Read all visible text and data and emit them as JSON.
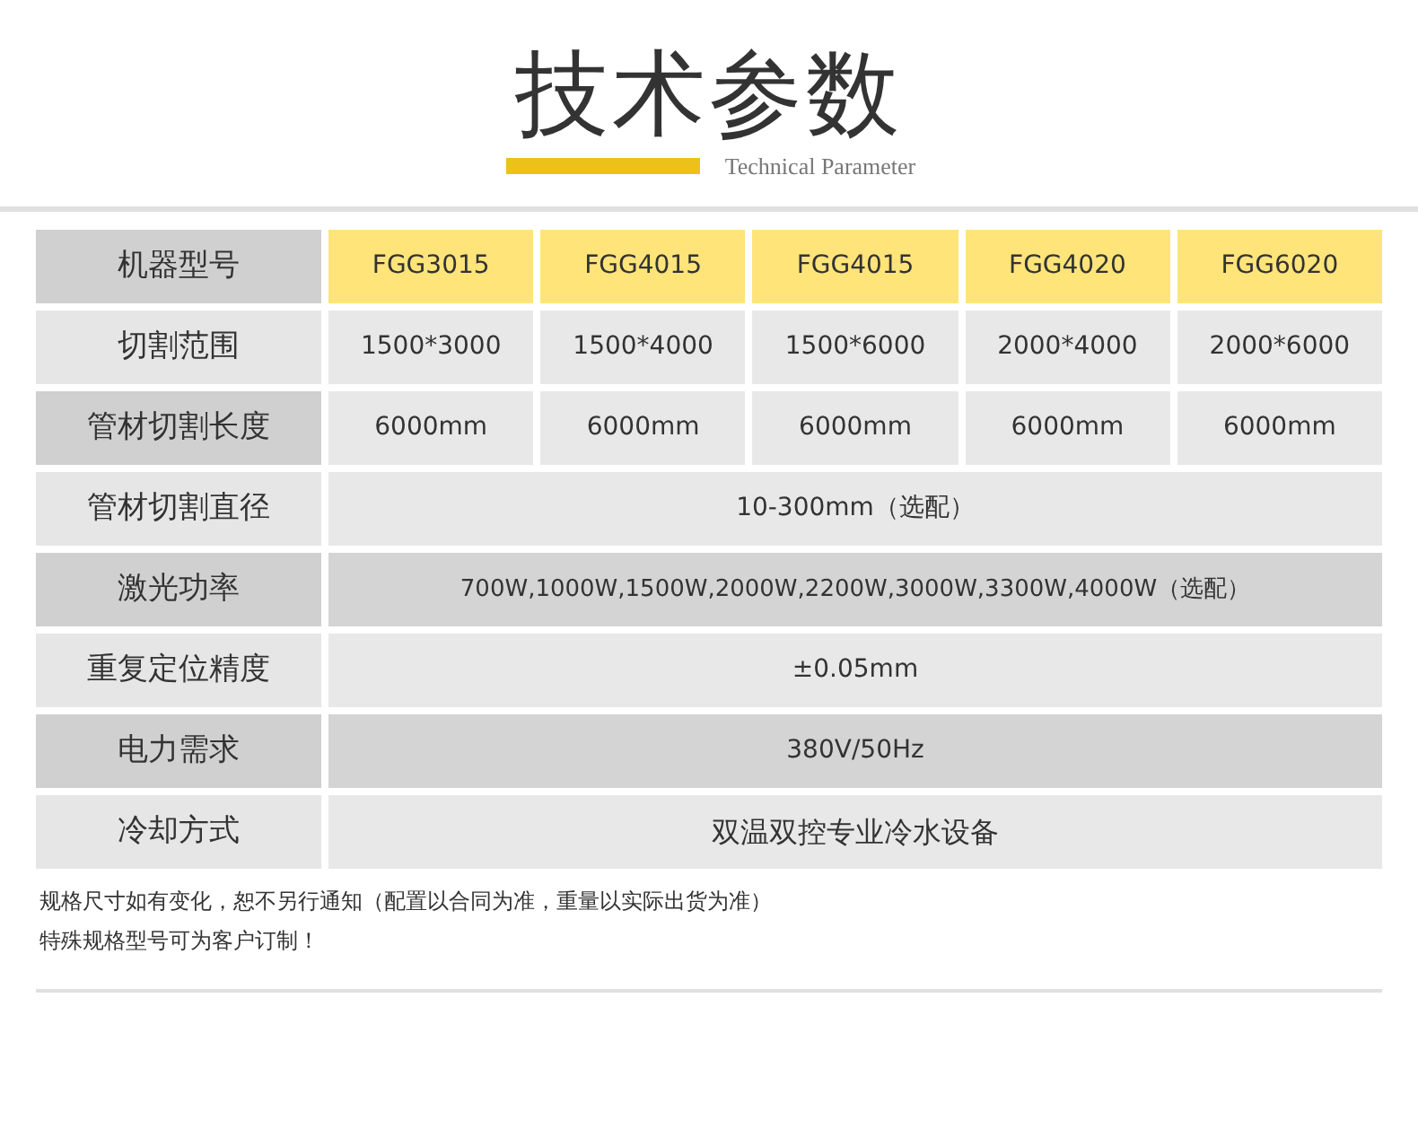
{
  "title": "技术参数",
  "subtitle": "Technical Parameter",
  "rows": [
    {
      "kind": "models",
      "label": "机器型号",
      "cells": [
        "FGG3015",
        "FGG4015",
        "FGG4015",
        "FGG4020",
        "FGG6020"
      ]
    },
    {
      "kind": "spec",
      "label": "切割范围",
      "cells": [
        "1500*3000",
        "1500*4000",
        "1500*6000",
        "2000*4000",
        "2000*6000"
      ]
    },
    {
      "kind": "spec",
      "label": "管材切割长度",
      "cells": [
        "6000mm",
        "6000mm",
        "6000mm",
        "6000mm",
        "6000mm"
      ]
    },
    {
      "kind": "spec",
      "label": "管材切割直径",
      "cells": [
        "10-300mm（选配）"
      ]
    },
    {
      "kind": "spec",
      "label": "激光功率",
      "cells": [
        "700W,1000W,1500W,2000W,2200W,3000W,3300W,4000W（选配）"
      ]
    },
    {
      "kind": "spec",
      "label": "重复定位精度",
      "cells": [
        "±0.05mm"
      ]
    },
    {
      "kind": "spec",
      "label": "电力需求",
      "cells": [
        "380V/50Hz"
      ]
    },
    {
      "kind": "spec",
      "label": "冷却方式",
      "cells": [
        "双温双控专业冷水设备"
      ]
    }
  ],
  "notes": [
    "规格尺寸如有变化，恕不另行通知（配置以合同为准，重量以实际出货为准）",
    "特殊规格型号可为客户订制！"
  ]
}
